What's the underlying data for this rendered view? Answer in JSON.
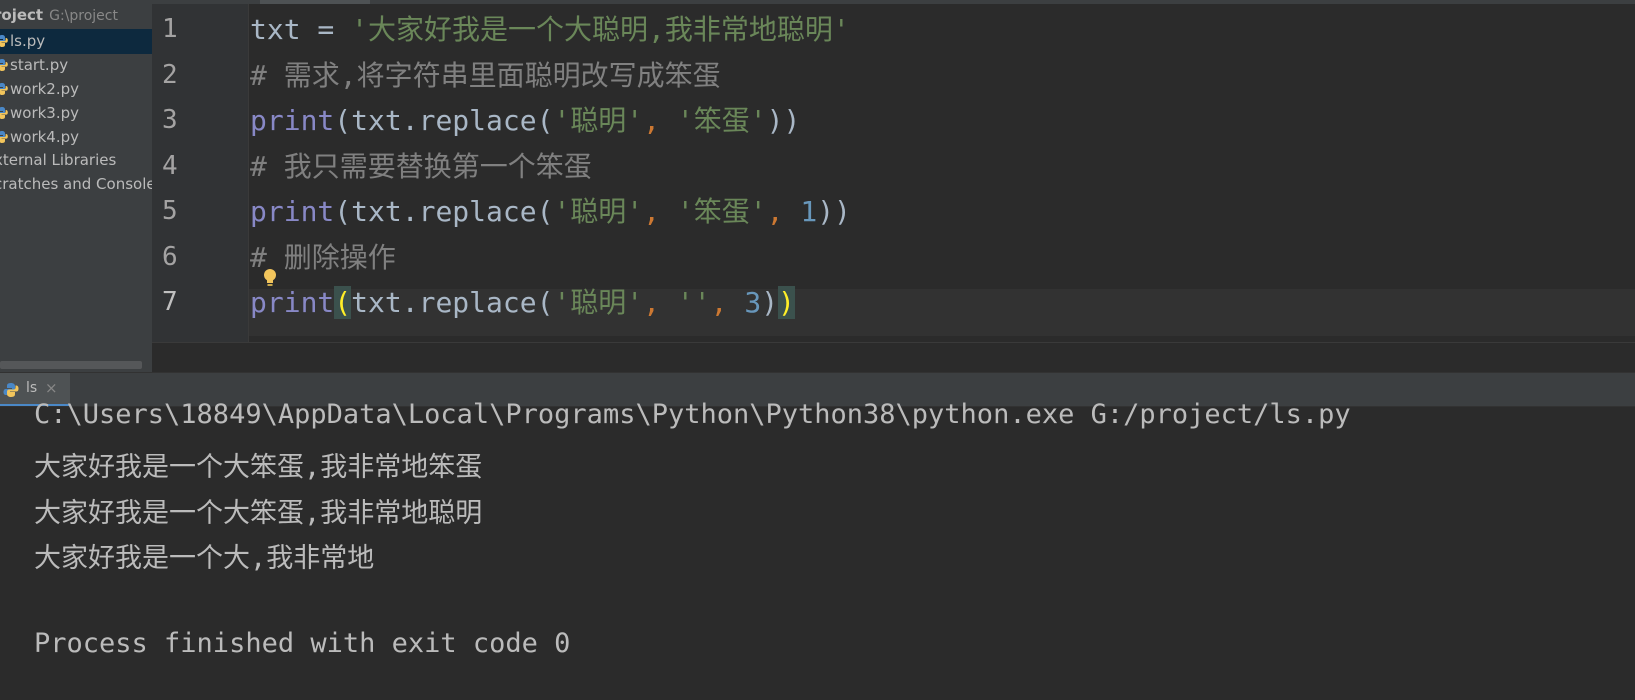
{
  "project": {
    "header_title": "roject",
    "header_path": "G:\\project",
    "files": [
      {
        "label": "ls.py",
        "selected": true
      },
      {
        "label": "start.py",
        "selected": false
      },
      {
        "label": "work2.py",
        "selected": false
      },
      {
        "label": "work3.py",
        "selected": false
      },
      {
        "label": "work4.py",
        "selected": false
      }
    ],
    "external_libraries": "xternal Libraries",
    "scratches": "cratches and Consoles"
  },
  "editor": {
    "line_numbers": [
      "1",
      "2",
      "3",
      "4",
      "5",
      "6",
      "7"
    ],
    "lines": [
      {
        "segments": [
          {
            "t": "txt = ",
            "c": ""
          },
          {
            "t": "'大家好我是一个大聪明,我非常地聪明'",
            "c": "str"
          }
        ]
      },
      {
        "segments": [
          {
            "t": "# 需求,将字符串里面聪明改写成笨蛋",
            "c": "cmt"
          }
        ]
      },
      {
        "segments": [
          {
            "t": "print",
            "c": "kw"
          },
          {
            "t": "(txt.replace(",
            "c": ""
          },
          {
            "t": "'聪明'",
            "c": "str"
          },
          {
            "t": ", ",
            "c": "comma"
          },
          {
            "t": "'笨蛋'",
            "c": "str"
          },
          {
            "t": "))",
            "c": ""
          }
        ]
      },
      {
        "segments": [
          {
            "t": "# 我只需要替换第一个笨蛋",
            "c": "cmt"
          }
        ]
      },
      {
        "segments": [
          {
            "t": "print",
            "c": "kw"
          },
          {
            "t": "(txt.replace(",
            "c": ""
          },
          {
            "t": "'聪明'",
            "c": "str"
          },
          {
            "t": ", ",
            "c": "comma"
          },
          {
            "t": "'笨蛋'",
            "c": "str"
          },
          {
            "t": ", ",
            "c": "comma"
          },
          {
            "t": "1",
            "c": "num"
          },
          {
            "t": "))",
            "c": ""
          }
        ]
      },
      {
        "segments": [
          {
            "t": "# 删除操作",
            "c": "cmt"
          }
        ]
      },
      {
        "segments": [
          {
            "t": "print",
            "c": "kw"
          },
          {
            "t": "(",
            "c": "bracket-hl"
          },
          {
            "t": "txt.replace(",
            "c": ""
          },
          {
            "t": "'聪明'",
            "c": "str"
          },
          {
            "t": ", ",
            "c": "comma"
          },
          {
            "t": "''",
            "c": "str"
          },
          {
            "t": ", ",
            "c": "comma"
          },
          {
            "t": "3",
            "c": "num"
          },
          {
            "t": ")",
            "c": ""
          },
          {
            "t": ")",
            "c": "bracket-hl"
          }
        ]
      }
    ]
  },
  "run": {
    "tab_label": "ls",
    "tab_close": "×",
    "output": [
      "C:\\Users\\18849\\AppData\\Local\\Programs\\Python\\Python38\\python.exe G:/project/ls.py",
      "大家好我是一个大笨蛋,我非常地笨蛋",
      "大家好我是一个大笨蛋,我非常地聪明",
      "大家好我是一个大,我非常地",
      "",
      "Process finished with exit code 0"
    ]
  },
  "colors": {
    "keyword": "#8888c6",
    "string": "#6a8759",
    "comment": "#808080",
    "number": "#6897bb",
    "comma": "#cc7832",
    "selection": "#0d293e"
  }
}
